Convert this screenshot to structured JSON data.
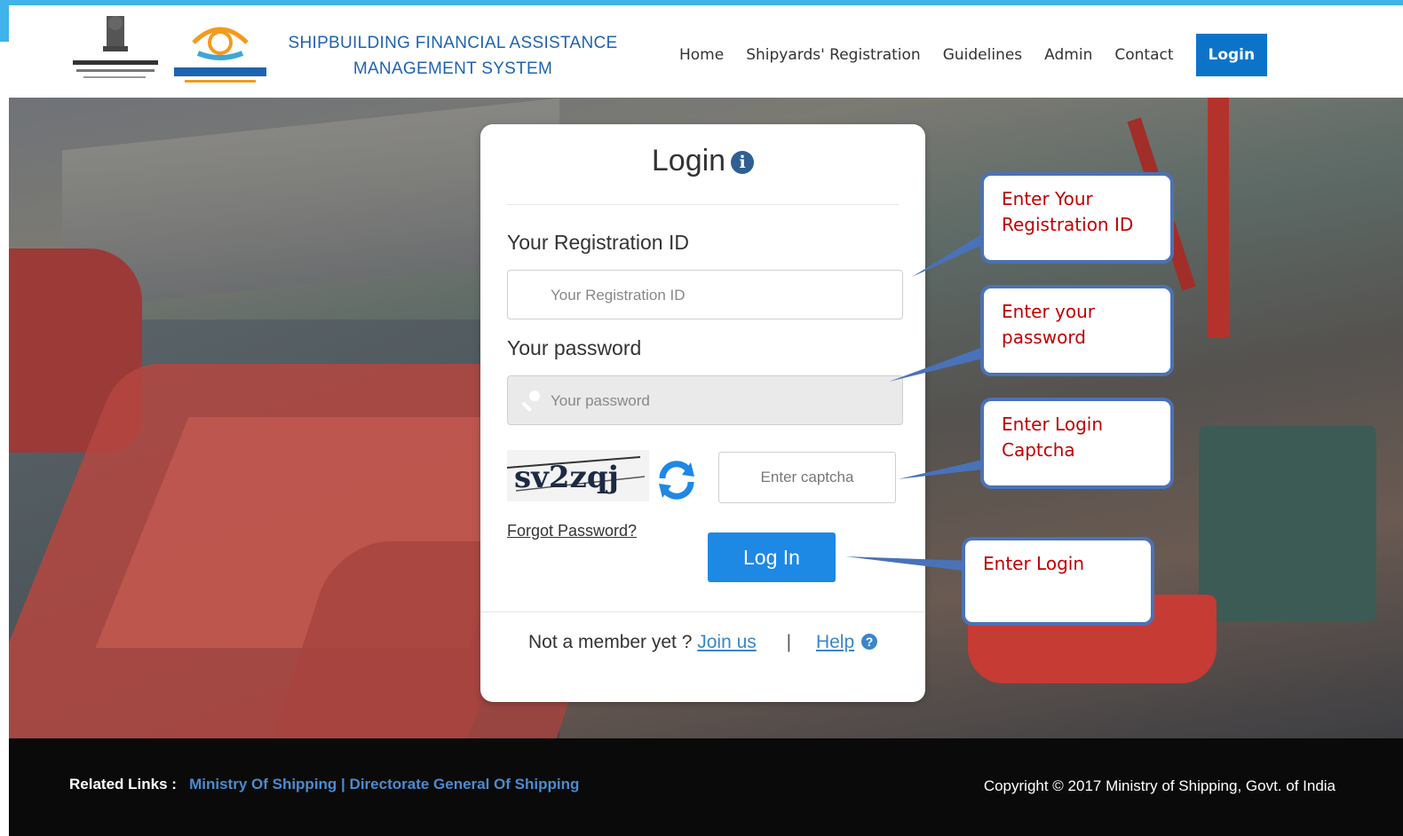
{
  "header": {
    "ministry_logo_alt": "MINISTRY OF SHIPPING",
    "sagarmala_logo_alt": "SAGARMALA",
    "title_line1": "SHIPBUILDING FINANCIAL ASSISTANCE",
    "title_line2": "MANAGEMENT SYSTEM"
  },
  "nav": {
    "items": [
      "Home",
      "Shipyards' Registration",
      "Guidelines",
      "Admin",
      "Contact"
    ],
    "login_label": "Login"
  },
  "login_card": {
    "title": "Login",
    "info_icon": "info-icon",
    "registration_label": "Your Registration ID",
    "registration_placeholder": "Your Registration ID",
    "password_label": "Your password",
    "password_placeholder": "Your password",
    "captcha_text": "sv2zqj",
    "captcha_placeholder": "Enter captcha",
    "forgot_password": "Forgot Password?",
    "submit_label": "Log In",
    "not_member": "Not a member yet ?",
    "join_us": "Join us",
    "separator": "|",
    "help": "Help"
  },
  "callouts": {
    "registration": "Enter Your Registration ID",
    "password": "Enter your password",
    "captcha": "Enter Login Captcha",
    "login": "Enter Login"
  },
  "footer": {
    "related_label": "Related Links :",
    "links": [
      "Ministry Of Shipping",
      "Directorate General Of Shipping"
    ],
    "link_separator": "|",
    "copyright": "Copyright © 2017 Ministry of Shipping, Govt. of India"
  },
  "colors": {
    "accent": "#0b74c9",
    "title_blue": "#1e63b0",
    "callout_border": "#4a72b8",
    "callout_text": "#c00000",
    "submit_blue": "#1e88e5"
  }
}
